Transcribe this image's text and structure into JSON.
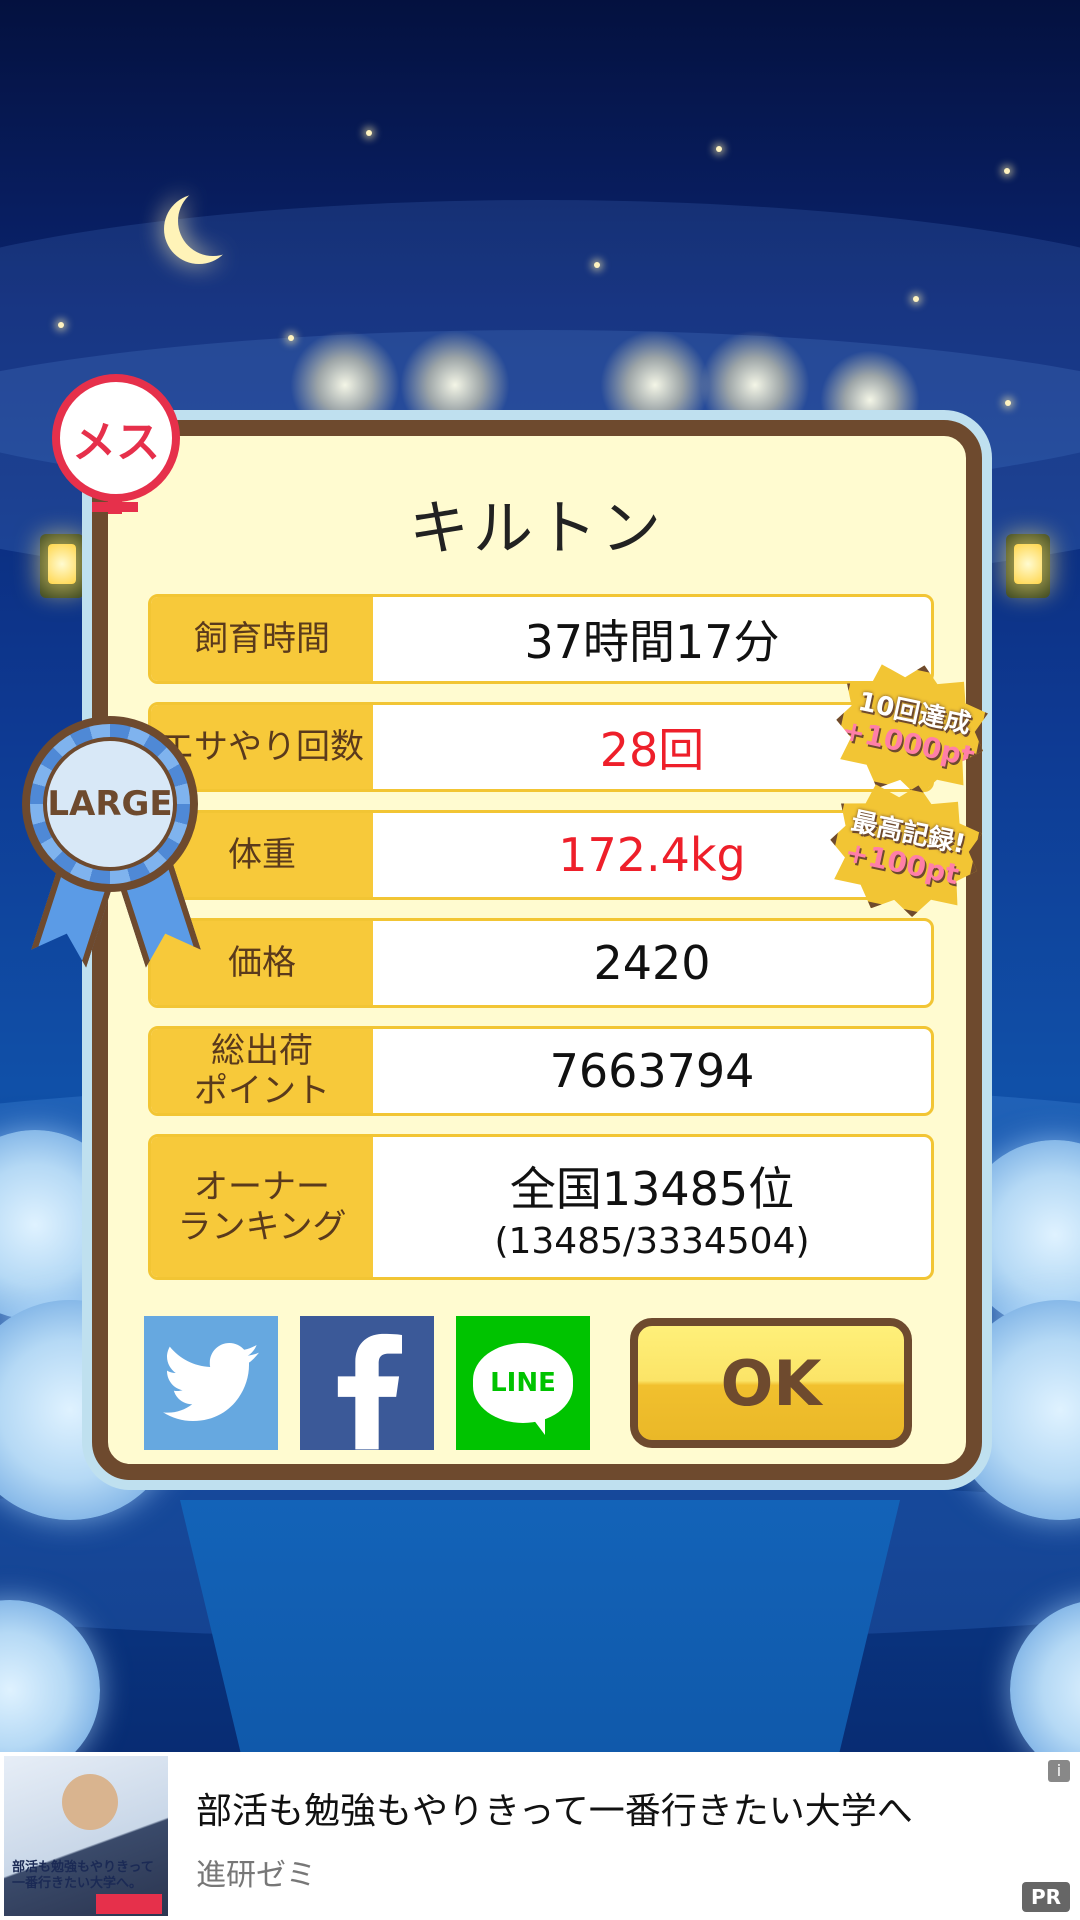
{
  "pet": {
    "name": "キルトン",
    "gender_badge": "メス",
    "size_badge": "LARGE"
  },
  "stats": [
    {
      "label": "飼育時間",
      "value": "37時間17分"
    },
    {
      "label": "エサやり回数",
      "value": "28回"
    },
    {
      "label": "体重",
      "value": "172.4kg"
    },
    {
      "label": "価格",
      "value": "2420"
    },
    {
      "label": "総出荷\nポイント",
      "value": "7663794"
    },
    {
      "label": "オーナー\nランキング",
      "value": "全国13485位",
      "sub": "(13485/3334504)"
    }
  ],
  "achievements": [
    {
      "line1": "10回達成",
      "line2": "+1000pt"
    },
    {
      "line1": "最高記録!",
      "line2": "+100pt"
    }
  ],
  "share": {
    "twitter_icon": "twitter-bird-icon",
    "facebook_icon": "facebook-f-icon",
    "line_label": "LINE"
  },
  "ok_label": "OK",
  "ad": {
    "title": "部活も勉強もやりきって一番行きたい大学へ",
    "sponsor": "進研ゼミ",
    "pr": "PR",
    "info": "i",
    "thumb_caption": "部活も勉強もやりきって一番行きたい大学へ。"
  },
  "colors": {
    "frame_brown": "#6e4a2e",
    "label_yellow": "#f7c93a",
    "highlight_red": "#ee1f2a",
    "twitter_blue": "#66a8e0",
    "facebook_blue": "#3b5998",
    "line_green": "#00c300"
  }
}
